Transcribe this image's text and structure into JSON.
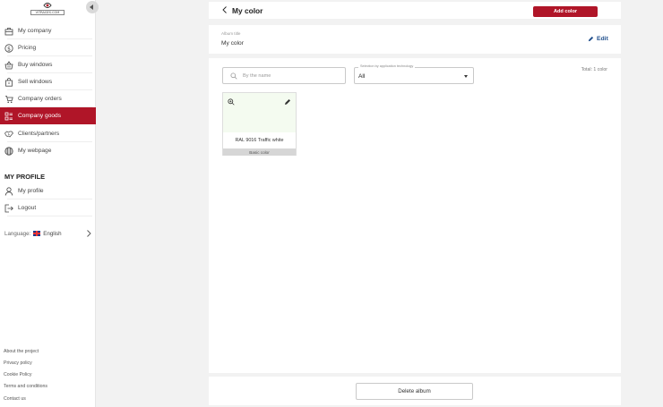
{
  "sidebar": {
    "logo_text": "VITRAGES.COM",
    "nav_items": [
      {
        "label": "My company",
        "icon": "briefcase-icon"
      },
      {
        "label": "Pricing",
        "icon": "dollar-circle-icon"
      },
      {
        "label": "Buy windows",
        "icon": "basket-icon"
      },
      {
        "label": "Sell windows",
        "icon": "bag-icon"
      },
      {
        "label": "Company orders",
        "icon": "cart-icon"
      },
      {
        "label": "Company goods",
        "icon": "list-grid-icon",
        "active": true
      },
      {
        "label": "Clients/partners",
        "icon": "handshake-icon"
      },
      {
        "label": "My webpage",
        "icon": "globe-icon"
      }
    ],
    "profile_heading": "MY PROFILE",
    "profile_items": [
      {
        "label": "My profile",
        "icon": "user-icon"
      },
      {
        "label": "Logout",
        "icon": "logout-icon"
      }
    ],
    "language": {
      "label": "Language:",
      "value": "English",
      "icon": "uk-flag-icon"
    },
    "footer_links": [
      "About the project",
      "Privacy policy",
      "Cookie Policy",
      "Terms and conditions",
      "Contact us"
    ],
    "accent_color": "#b01528"
  },
  "header": {
    "title": "My color",
    "add_button": "Add color"
  },
  "album": {
    "title_label": "Album title",
    "title_value": "My color",
    "edit_label": "Edit"
  },
  "filters": {
    "search_placeholder": "By the name",
    "select_label": "Selection by application technology",
    "select_value": "All",
    "total": "Total: 1 color"
  },
  "colors": [
    {
      "name": "RAL 9016 Traffic white",
      "badge": "Basic color",
      "swatch": "#f4fbf0"
    }
  ],
  "footer": {
    "delete_button": "Delete album"
  }
}
